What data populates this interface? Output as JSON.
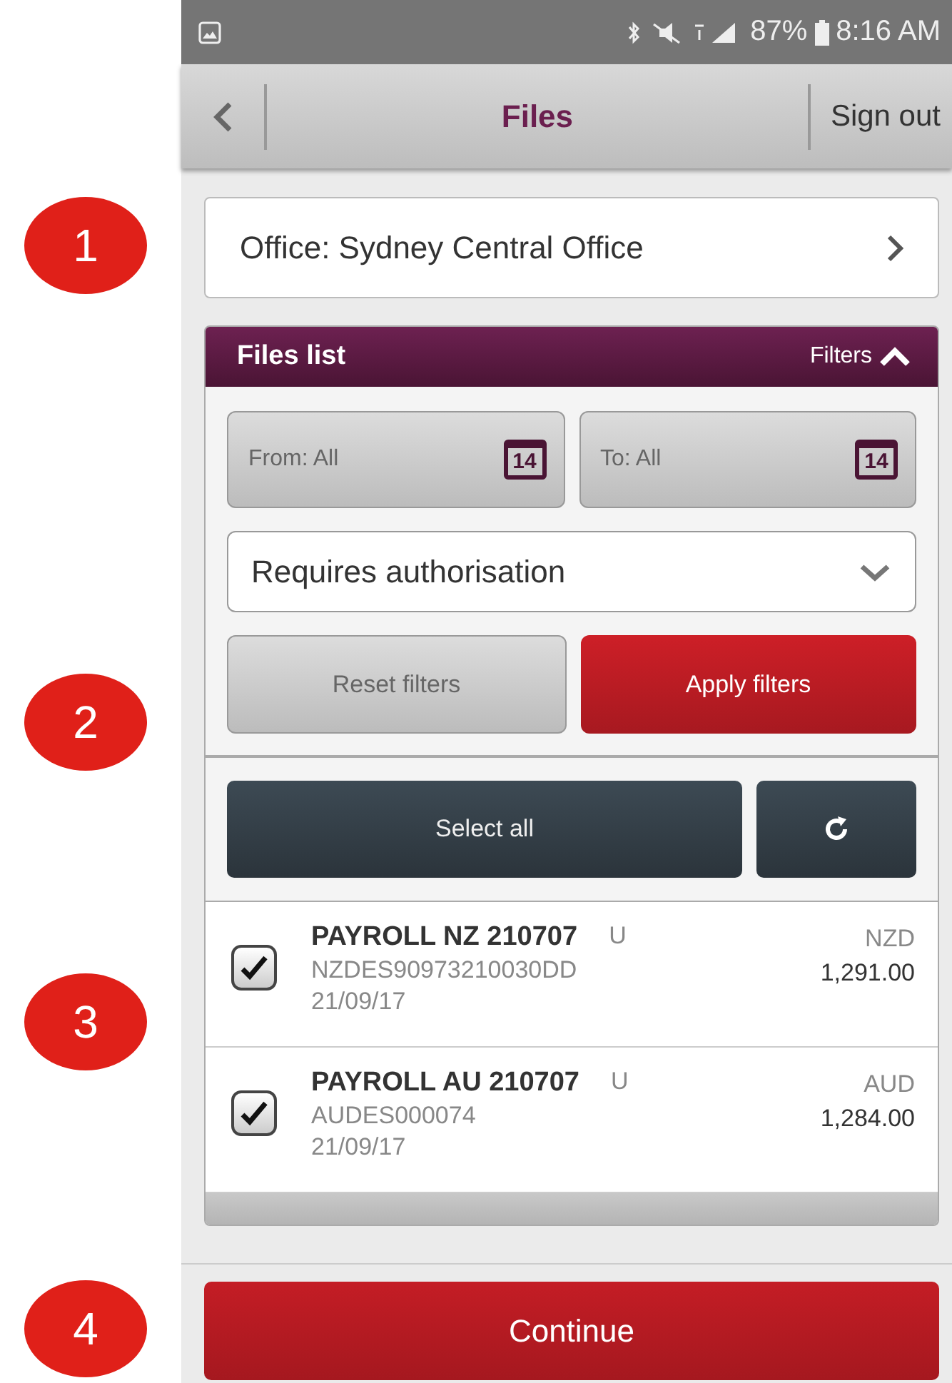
{
  "callouts": [
    "1",
    "2",
    "3",
    "4"
  ],
  "status_bar": {
    "battery": "87%",
    "time": "8:16 AM"
  },
  "header": {
    "title": "Files",
    "sign_out": "Sign out"
  },
  "office": {
    "label": "Office: Sydney Central Office"
  },
  "files_panel": {
    "title": "Files list",
    "filters_toggle": "Filters",
    "filters_expanded": true,
    "from_date": {
      "label": "From: All",
      "icon_day": "14"
    },
    "to_date": {
      "label": "To: All",
      "icon_day": "14"
    },
    "status_select": {
      "value": "Requires authorisation"
    },
    "reset_button": "Reset filters",
    "apply_button": "Apply filters",
    "select_all_button": "Select all"
  },
  "files": [
    {
      "name": "PAYROLL NZ 210707",
      "flag": "U",
      "reference": "NZDES90973210030DD",
      "date": "21/09/17",
      "currency": "NZD",
      "amount": "1,291.00",
      "checked": true
    },
    {
      "name": "PAYROLL AU 210707",
      "flag": "U",
      "reference": "AUDES000074",
      "date": "21/09/17",
      "currency": "AUD",
      "amount": "1,284.00",
      "checked": true
    }
  ],
  "continue_button": "Continue"
}
